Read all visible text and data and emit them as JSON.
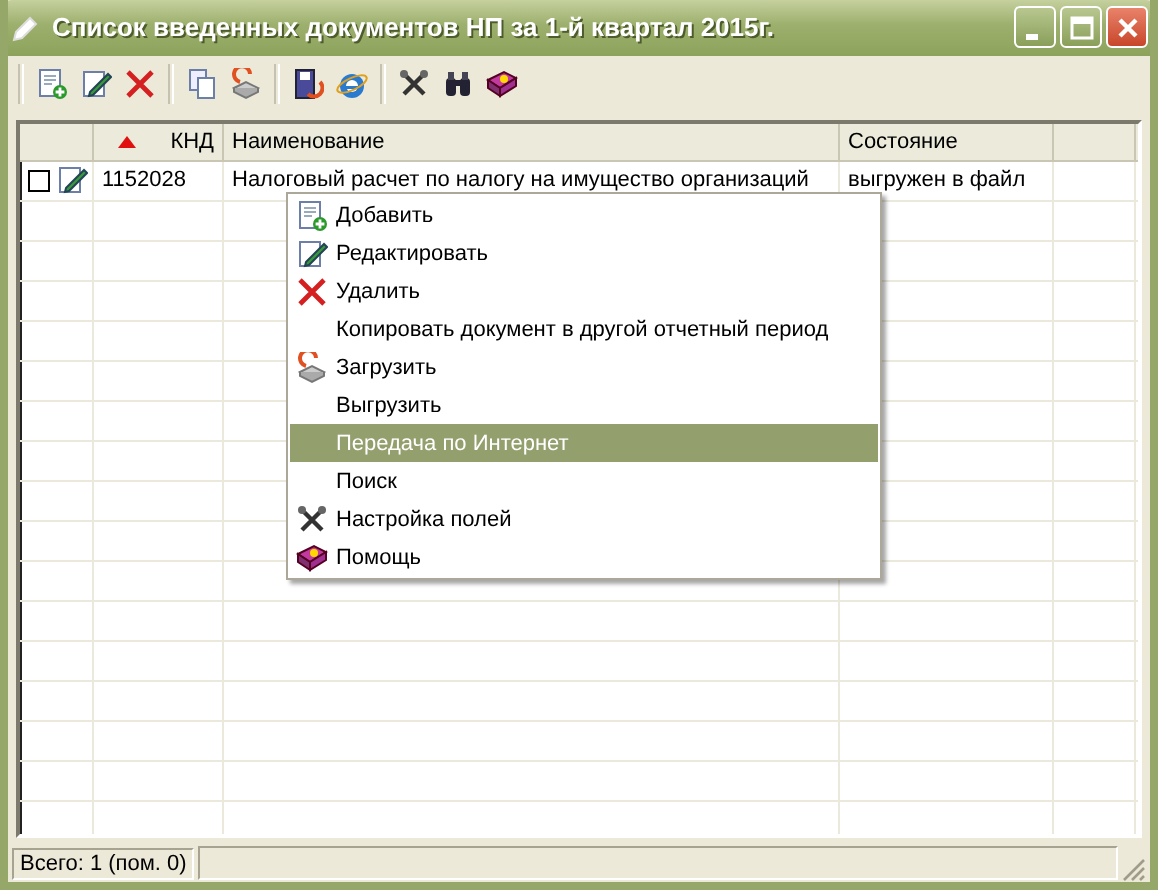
{
  "window": {
    "title": "Список введенных документов НП за 1-й квартал 2015г."
  },
  "table": {
    "columns": [
      {
        "sorted": false
      },
      {
        "label": "КНД",
        "sorted": true
      },
      {
        "label": "Наименование",
        "sorted": false
      },
      {
        "label": "Состояние",
        "sorted": false
      },
      {
        "sorted": false
      }
    ],
    "rows": [
      {
        "checked": false,
        "knd": "1152028",
        "name": "Налоговый расчет по налогу на имущество организаций",
        "state": "выгружен в файл"
      }
    ]
  },
  "context_menu": {
    "items": [
      {
        "label": "Добавить",
        "selected": false
      },
      {
        "label": "Редактировать",
        "selected": false
      },
      {
        "label": "Удалить",
        "selected": false
      },
      {
        "label": "Копировать документ в другой отчетный период",
        "selected": false
      },
      {
        "label": "Загрузить",
        "selected": false
      },
      {
        "label": "Выгрузить",
        "selected": false
      },
      {
        "label": "Передача по Интернет",
        "selected": true
      },
      {
        "label": "Поиск",
        "selected": false
      },
      {
        "label": "Настройка полей",
        "selected": false
      },
      {
        "label": "Помощь",
        "selected": false
      }
    ]
  },
  "status_bar": {
    "text": "Всего: 1 (пом. 0)"
  }
}
